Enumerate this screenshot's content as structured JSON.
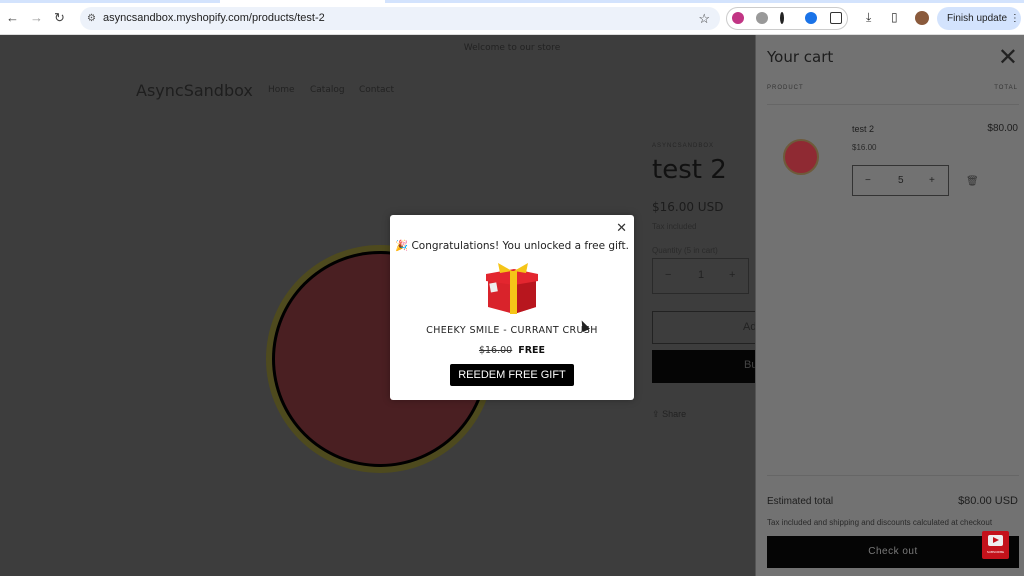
{
  "browser": {
    "url": "asyncsandbox.myshopify.com/products/test-2",
    "finish_update": "Finish update"
  },
  "store": {
    "announcement": "Welcome to our store",
    "logo": "AsyncSandbox",
    "menu": [
      "Home",
      "Catalog",
      "Contact"
    ]
  },
  "product": {
    "vendor": "ASYNCSANDBOX",
    "title": "test 2",
    "price": "$16.00 USD",
    "tax": "Tax included",
    "quantity_label": "Quantity (5 in cart)",
    "quantity": "1",
    "add_to_cart": "Ad",
    "buy_now": "Bu",
    "share": "Share"
  },
  "cart": {
    "title": "Your cart",
    "col_product": "PRODUCT",
    "col_total": "TOTAL",
    "item": {
      "name": "test 2",
      "price": "$16.00",
      "quantity": "5",
      "total": "$80.00"
    },
    "estimated_label": "Estimated total",
    "estimated_value": "$80.00 USD",
    "note": "Tax included and shipping and discounts calculated at checkout",
    "checkout": "Check out"
  },
  "modal": {
    "message": "🎉 Congratulations! You unlocked a free gift.",
    "gift_name": "CHEEKY SMILE - CURRANT CRUSH",
    "old_price": "$16.00",
    "new_price": "FREE",
    "redeem": "REEDEM FREE GIFT"
  },
  "youtube": {
    "label": "SUBSCRIBE"
  },
  "colors": {
    "accent": "#d3e3fd",
    "button": "#000000",
    "gift_red": "#d9232b",
    "gift_ribbon": "#f5c518"
  }
}
